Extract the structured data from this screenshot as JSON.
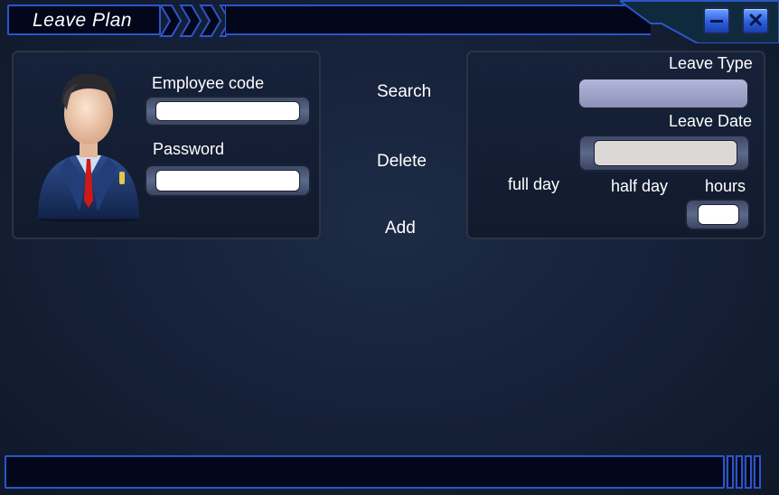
{
  "window": {
    "title": "Leave Plan",
    "minimize_icon": "minimize-icon",
    "close_icon": "close-icon",
    "accent_color": "#2d55c8",
    "button_color": "#4a7ff0"
  },
  "employee_panel": {
    "avatar_icon": "businessman-avatar-icon",
    "employee_code_label": "Employee code",
    "employee_code_value": "",
    "password_label": "Password",
    "password_value": ""
  },
  "actions": {
    "search_label": "Search",
    "delete_label": "Delete",
    "add_label": "Add"
  },
  "leave_panel": {
    "leave_type_label": "Leave Type",
    "leave_type_value": "",
    "leave_date_label": "Leave Date",
    "leave_date_value": "",
    "full_day_label": "full day",
    "half_day_label": "half day",
    "hours_label": "hours",
    "hours_value": ""
  }
}
